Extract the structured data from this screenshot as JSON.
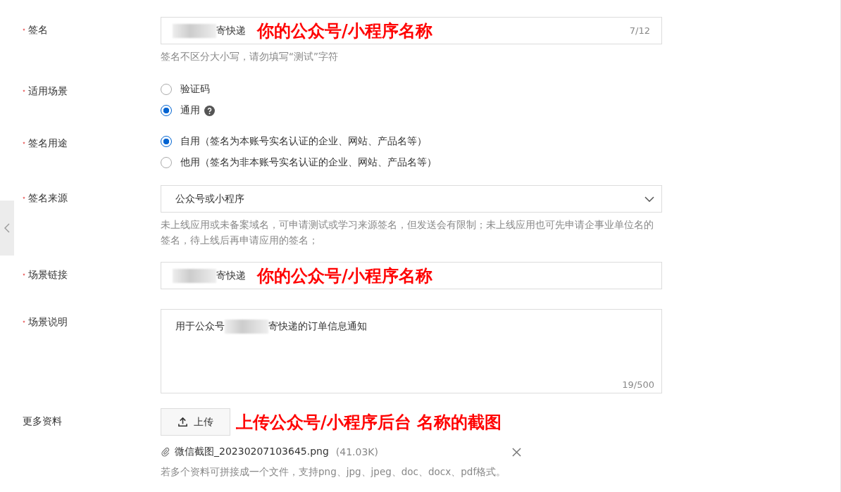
{
  "fields": [
    {
      "kind": "input",
      "label": "签名",
      "required": true,
      "value": "寄快递",
      "redacted": true,
      "counter": "7/12",
      "annotation": "你的公众号/小程序名称",
      "hint": "签名不区分大小写，请勿填写“测试”字符"
    },
    {
      "kind": "radio",
      "label": "适用场景",
      "required": true,
      "options": [
        {
          "label": "验证码",
          "selected": false,
          "help": false
        },
        {
          "label": "通用",
          "selected": true,
          "help": true
        }
      ]
    },
    {
      "kind": "radio",
      "label": "签名用途",
      "required": true,
      "options": [
        {
          "label": "自用（签名为本账号实名认证的企业、网站、产品名等）",
          "selected": true,
          "help": false
        },
        {
          "label": "他用（签名为非本账号实名认证的企业、网站、产品名等）",
          "selected": false,
          "help": false
        }
      ]
    },
    {
      "kind": "select",
      "label": "签名来源",
      "required": true,
      "value": "公众号或小程序",
      "hint": "未上线应用或未备案域名，可申请测试或学习来源签名，但发送会有限制；未上线应用也可先申请企事业单位名的签名，待上线后再申请应用的签名；"
    },
    {
      "kind": "input",
      "label": "场景链接",
      "required": true,
      "value": "寄快递",
      "redacted": true,
      "annotation": "你的公众号/小程序名称"
    },
    {
      "kind": "textarea",
      "label": "场景说明",
      "required": true,
      "value_before": "用于公众号",
      "value_after": "寄快递的订单信息通知",
      "counter": "19/500"
    },
    {
      "kind": "upload",
      "label": "更多资料",
      "required": false,
      "button": "上传",
      "annotation": "上传公众号/小程序后台 名称的截图",
      "file": {
        "name": "微信截图_20230207103645.png",
        "size": "(41.03K)"
      },
      "hint": "若多个资料可拼接成一个文件，支持png、jpg、jpeg、doc、docx、pdf格式。"
    }
  ]
}
